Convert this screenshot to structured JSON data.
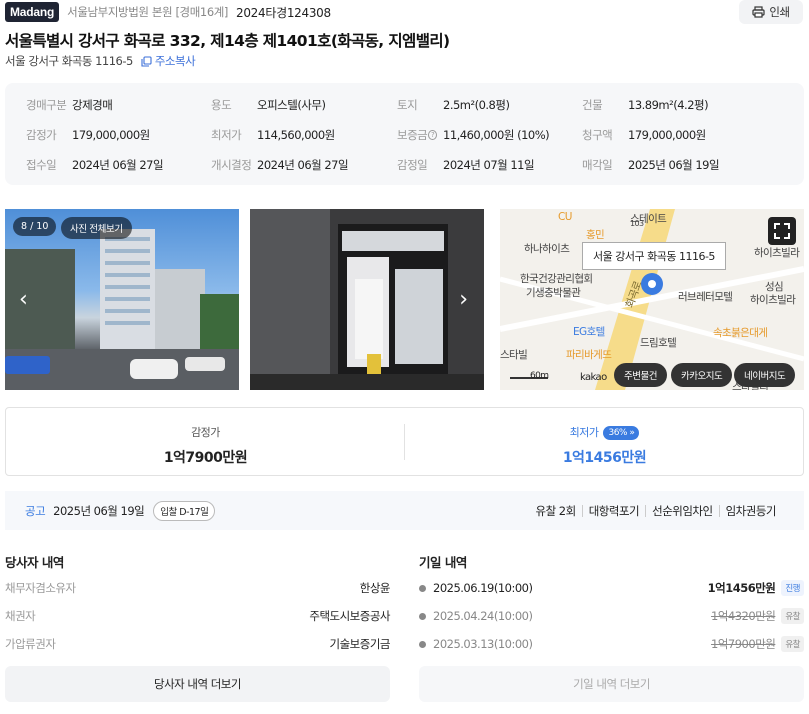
{
  "header": {
    "logo": "Madang",
    "court": "서울남부지방법원 본원 [경매16계]",
    "case_number": "2024타경124308",
    "print_label": "인쇄"
  },
  "title": "서울특별시 강서구 화곡로 332, 제14층 제1401호(화곡동, 지엠밸리)",
  "address": {
    "jibun": "서울 강서구 화곡동 1116-5",
    "copy_label": "주소복사"
  },
  "info": {
    "auction_type_label": "경매구분",
    "auction_type": "강제경매",
    "use_label": "용도",
    "use": "오피스텔(사무)",
    "land_label": "토지",
    "land": "2.5m²(0.8평)",
    "building_label": "건물",
    "building": "13.89m²(4.2평)",
    "appraisal_label": "감정가",
    "appraisal": "179,000,000원",
    "min_label": "최저가",
    "min": "114,560,000원",
    "deposit_label": "보증금",
    "deposit": "11,460,000원 (10%)",
    "claim_label": "청구액",
    "claim": "179,000,000원",
    "received_label": "접수일",
    "received": "2024년 06월 27일",
    "start_label": "개시결정",
    "start": "2024년 06월 27일",
    "appraise_date_label": "감정일",
    "appraise_date": "2024년 07월 11일",
    "sale_date_label": "매각일",
    "sale_date": "2025년 06월 19일"
  },
  "gallery": {
    "counter": "8 / 10",
    "view_all": "사진 전체보기"
  },
  "map": {
    "tooltip": "서울 강서구 화곡동 1116-5",
    "labels": [
      "CU",
      "홍민",
      "하나하이츠",
      "한국건강관리협회",
      "기생충박물관",
      "화곡로",
      "러브레터모텔",
      "하이츠빌라",
      "성심",
      "하이츠빌라",
      "EG호텔",
      "드림호텔",
      "속초붉은대게",
      "스타빌",
      "파리바게뜨",
      "스테이트",
      "103",
      "스타빌리"
    ],
    "scale": "60m",
    "brand": "kakao",
    "buttons": [
      "주변물건",
      "카카오지도",
      "네이버지도"
    ]
  },
  "prices": {
    "appraisal_label": "감정가",
    "appraisal": "1억7900만원",
    "min_label": "최저가",
    "min_percent": "36%",
    "min": "1억1456만원"
  },
  "notice": {
    "label": "공고",
    "date": "2025년 06월 19일",
    "dday": "입찰 D-17일",
    "tags": [
      "유찰 2회",
      "대항력포기",
      "선순위임차인",
      "임차권등기"
    ]
  },
  "parties": {
    "title": "당사자 내역",
    "rows": [
      {
        "role": "채무자겸소유자",
        "name": "한상윤"
      },
      {
        "role": "채권자",
        "name": "주택도시보증공사"
      },
      {
        "role": "가압류권자",
        "name": "기술보증기금"
      }
    ],
    "more": "당사자 내역 더보기"
  },
  "history": {
    "title": "기일 내역",
    "rows": [
      {
        "date": "2025.06.19(10:00)",
        "price": "1억1456만원",
        "status": "진행"
      },
      {
        "date": "2025.04.24(10:00)",
        "price": "1억4320만원",
        "status": "유찰"
      },
      {
        "date": "2025.03.13(10:00)",
        "price": "1억7900만원",
        "status": "유찰"
      }
    ],
    "more": "기일 내역 더보기"
  },
  "colors": {
    "accent": "#3a7be0",
    "logo_bg": "#1f2433"
  }
}
